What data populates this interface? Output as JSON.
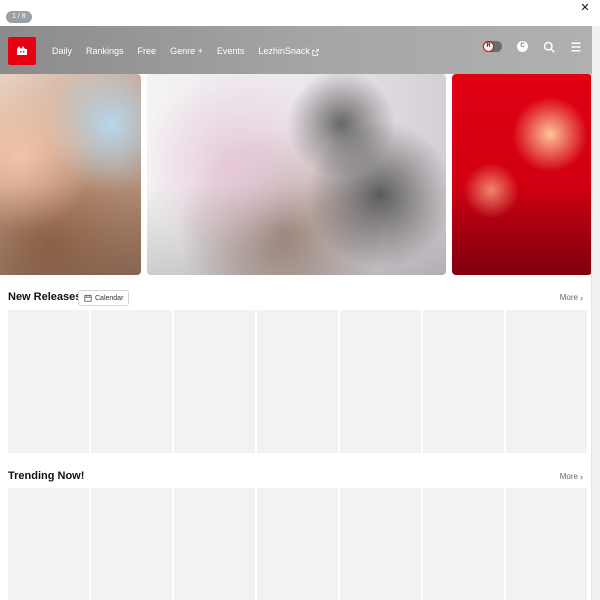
{
  "overlay": {
    "pager_text": "1 / 8",
    "close_symbol": "✕"
  },
  "header": {
    "logo_icon": "lezhin-logo-icon",
    "nav_items": [
      {
        "label": "Daily"
      },
      {
        "label": "Rankings"
      },
      {
        "label": "Free"
      },
      {
        "label": "Genre +"
      },
      {
        "label": "Events"
      },
      {
        "label": "LezhinSnack",
        "external": true
      }
    ],
    "toggle_label": "R",
    "coin_label": "C",
    "icons": [
      "search-icon",
      "menu-icon",
      "external-link-icon"
    ]
  },
  "sections": {
    "new_releases": {
      "title": "New Releases",
      "calendar_label": "Calendar",
      "more_label": "More"
    },
    "trending_now": {
      "title": "Trending Now!",
      "more_label": "More"
    }
  },
  "colors": {
    "brand_red": "#e60012",
    "card_placeholder": "#f2f2f2"
  }
}
